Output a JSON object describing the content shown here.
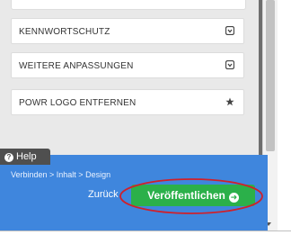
{
  "settings": {
    "items": [
      {
        "label": "KENNWORTSCHUTZ",
        "icon": "expand-box-icon"
      },
      {
        "label": "WEITERE ANPASSUNGEN",
        "icon": "expand-box-icon"
      },
      {
        "label": "POWR LOGO ENTFERNEN",
        "icon": "star-icon"
      }
    ]
  },
  "help": {
    "label": "Help",
    "icon": "question-circle-icon"
  },
  "footer": {
    "breadcrumb": "Verbinden > Inhalt > Design",
    "back_label": "Zurück",
    "publish_label": "Veröffentlichen",
    "publish_icon": "arrow-right-circle-icon",
    "bar_color": "#3f86dd",
    "publish_color": "#2bb04a",
    "highlight_color": "#d0202a"
  }
}
